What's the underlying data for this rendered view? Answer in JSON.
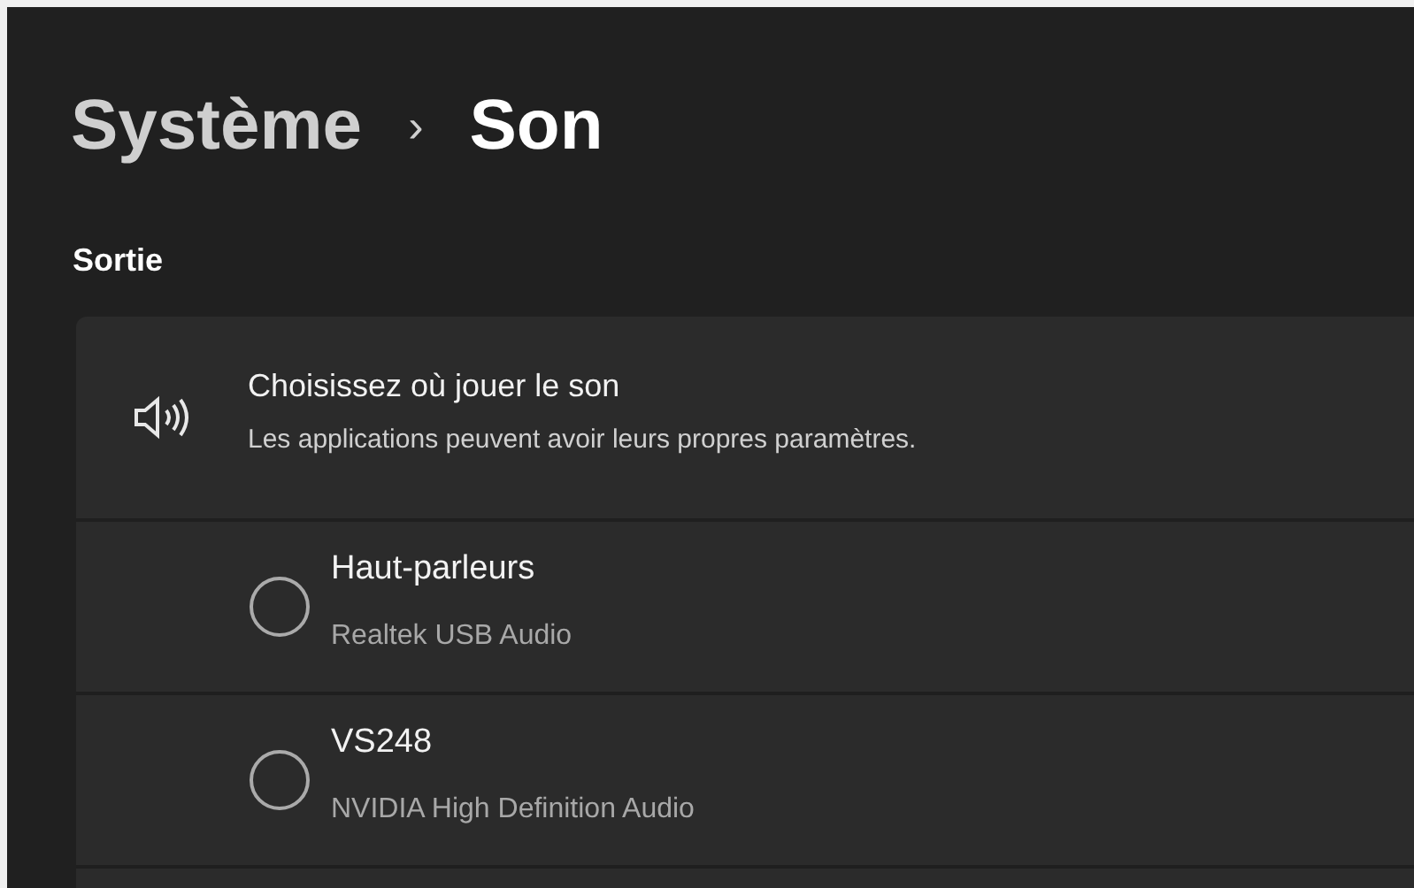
{
  "breadcrumb": {
    "parent": "Système",
    "separator": "›",
    "current": "Son"
  },
  "section": {
    "title": "Sortie"
  },
  "output_card": {
    "title": "Choisissez où jouer le son",
    "subtitle": "Les applications peuvent avoir leurs propres paramètres.",
    "devices": [
      {
        "name": "Haut-parleurs",
        "driver": "Realtek USB Audio",
        "selected": false
      },
      {
        "name": "VS248",
        "driver": "NVIDIA High Definition Audio",
        "selected": false
      }
    ]
  }
}
